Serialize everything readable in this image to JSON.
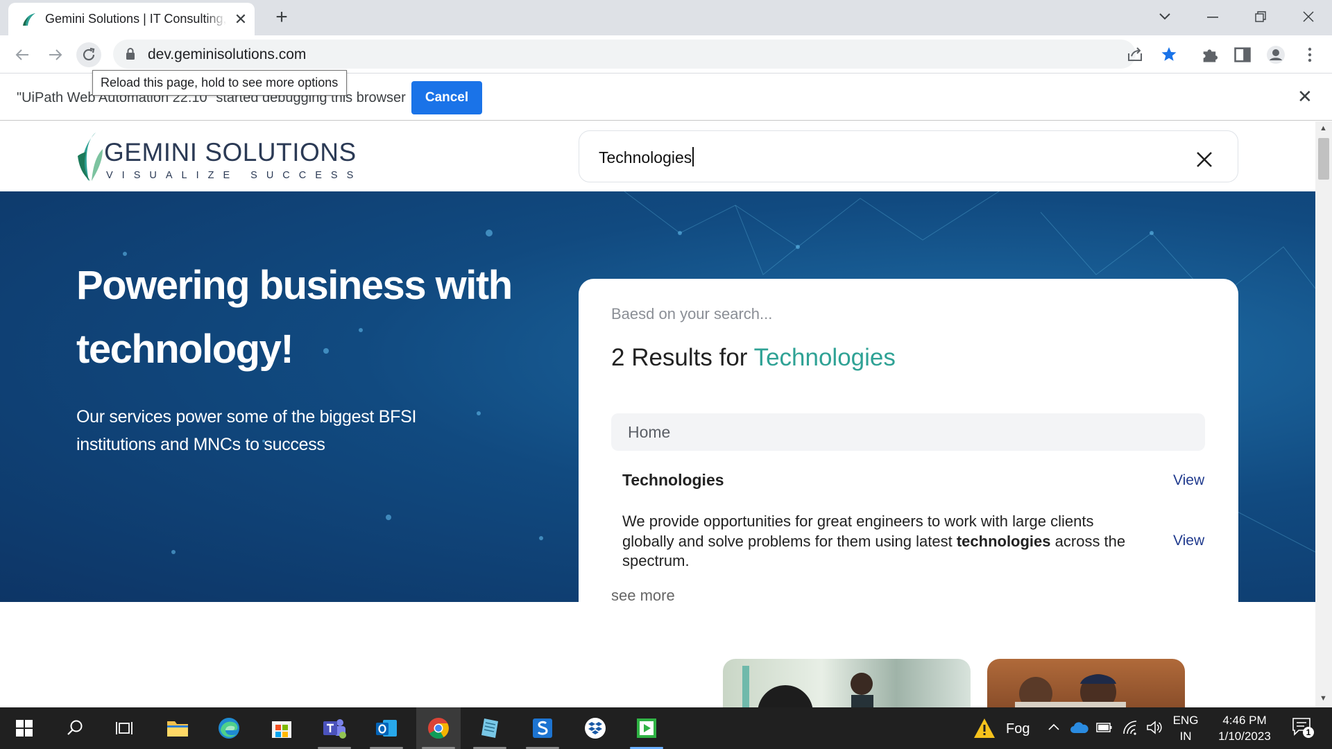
{
  "browser": {
    "tab_title": "Gemini Solutions | IT Consulting, Software Development",
    "url": "dev.geminisolutions.com",
    "tooltip": "Reload this page, hold to see more options",
    "debug_message": "\"UiPath Web Automation 22.10\" started debugging this browser",
    "cancel_label": "Cancel"
  },
  "site": {
    "logo_word": "GEMINI SOLUTIONS",
    "logo_tagline": "VISUALIZE SUCCESS",
    "search_value": "Technologies",
    "hero_title": "Powering business with technology!",
    "hero_subtitle": "Our services power some of the biggest BFSI institutions and MNCs to success"
  },
  "results": {
    "based_text": "Baesd on your search...",
    "count_prefix": "2 Results for",
    "query": "Technologies",
    "group_label": "Home",
    "item1_title": "Technologies",
    "view_label": "View",
    "item2_before": "We provide opportunities for great engineers to work with large clients globally and solve problems for them using latest",
    "item2_highlight": "technologies",
    "item2_after": "across the spectrum.",
    "see_more": "see more"
  },
  "taskbar": {
    "weather": "Fog",
    "lang_line1": "ENG",
    "lang_line2": "IN",
    "time": "4:46 PM",
    "date": "1/10/2023",
    "notification_count": "1"
  },
  "colors": {
    "accent_blue": "#1a73e8",
    "result_highlight": "#2fa295",
    "hero_bg": "#114a80",
    "link_view": "#203a8d"
  }
}
